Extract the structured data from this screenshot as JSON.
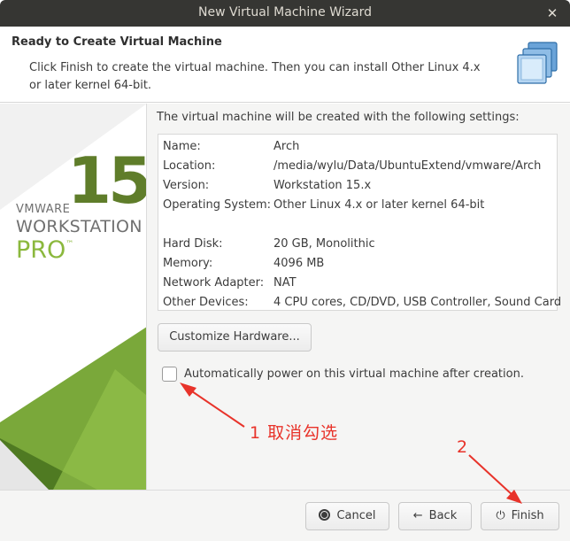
{
  "window": {
    "title": "New Virtual Machine Wizard",
    "close_glyph": "✕"
  },
  "header": {
    "title": "Ready to Create Virtual Machine",
    "description": "Click Finish to create the virtual machine. Then you can install Other Linux 4.x or later kernel 64-bit."
  },
  "branding": {
    "vendor": "VMWARE",
    "version": "15",
    "product": "WORKSTATION",
    "edition": "PRO",
    "tm": "™"
  },
  "summary": {
    "intro": "The virtual machine will be created with the following settings:",
    "rows": [
      {
        "label": "Name:",
        "value": "Arch"
      },
      {
        "label": "Location:",
        "value": "/media/wylu/Data/UbuntuExtend/vmware/Arch"
      },
      {
        "label": "Version:",
        "value": "Workstation 15.x"
      },
      {
        "label": "Operating System:",
        "value": "Other Linux 4.x or later kernel 64-bit"
      },
      {
        "label": "Hard Disk:",
        "value": "20 GB, Monolithic"
      },
      {
        "label": "Memory:",
        "value": "4096 MB"
      },
      {
        "label": "Network Adapter:",
        "value": "NAT"
      },
      {
        "label": "Other Devices:",
        "value": "4 CPU cores, CD/DVD, USB Controller, Sound Card"
      }
    ]
  },
  "customize_label": "Customize Hardware...",
  "power_on": {
    "label": "Automatically power on this virtual machine after creation.",
    "checked": false
  },
  "annotations": {
    "step1": "1 取消勾选",
    "step2": "2",
    "color": "#e8332a"
  },
  "footer": {
    "cancel_label": "Cancel",
    "back_label": "Back",
    "finish_label": "Finish"
  },
  "icons": {
    "header": "vm-stack-icon",
    "cancel": "stop-icon",
    "back": "arrow-left-icon",
    "finish": "power-icon"
  },
  "colors": {
    "titlebar": "#363633",
    "brand_dark": "#5f7d2a",
    "brand_light": "#8bb83d"
  }
}
